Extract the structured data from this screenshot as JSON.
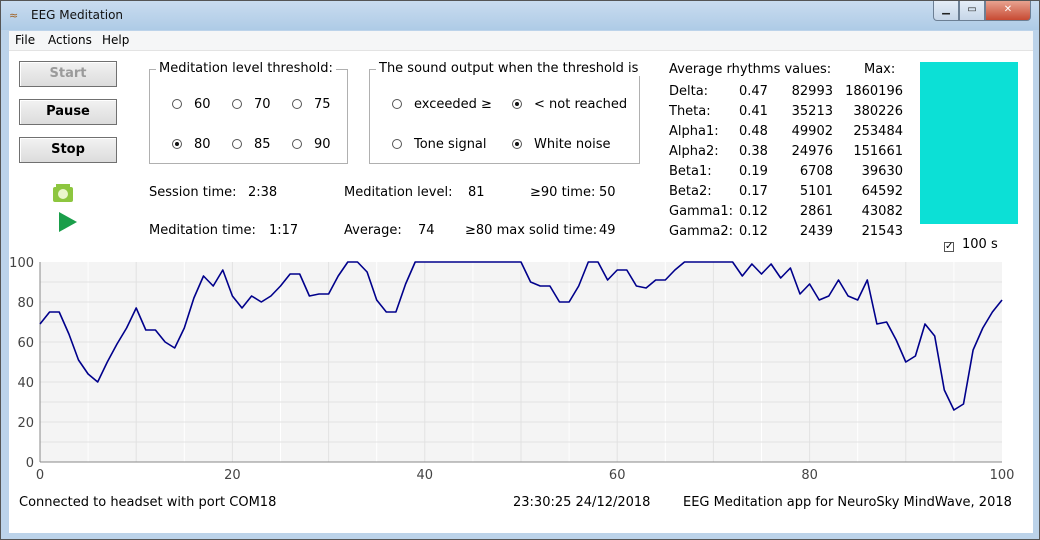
{
  "window": {
    "title": "EEG Meditation",
    "icon": "brain-wave-icon",
    "controls": [
      "minimize",
      "maximize",
      "close"
    ]
  },
  "menu": [
    "File",
    "Actions",
    "Help"
  ],
  "buttons": {
    "start": "Start",
    "pause": "Pause",
    "stop": "Stop"
  },
  "threshold_group": {
    "title": "Meditation level threshold:",
    "options": [
      "60",
      "70",
      "75",
      "80",
      "85",
      "90"
    ],
    "selected": "80"
  },
  "sound_group": {
    "title": "The sound output when the threshold is",
    "condition_options": [
      "exceeded ≥",
      "< not reached"
    ],
    "condition_selected": "< not reached",
    "signal_options": [
      "Tone signal",
      "White noise"
    ],
    "signal_selected": "White noise"
  },
  "stats": {
    "session_time_label": "Session time:",
    "session_time": "2:38",
    "meditation_level_label": "Meditation level:",
    "meditation_level": "81",
    "ge90_label": "≥90 time:",
    "ge90": "50",
    "meditation_time_label": "Meditation time:",
    "meditation_time": "1:17",
    "average_label": "Average:",
    "average": "74",
    "ge80_label": "≥80 max solid time:",
    "ge80": "49"
  },
  "rhythms": {
    "header": "Average rhythms values:",
    "max_header": "Max:",
    "rows": [
      {
        "name": "Delta:",
        "ratio": "0.47",
        "avg": "82993",
        "max": "1860196"
      },
      {
        "name": "Theta:",
        "ratio": "0.41",
        "avg": "35213",
        "max": "380226"
      },
      {
        "name": "Alpha1:",
        "ratio": "0.48",
        "avg": "49902",
        "max": "253484"
      },
      {
        "name": "Alpha2:",
        "ratio": "0.38",
        "avg": "24976",
        "max": "151661"
      },
      {
        "name": "Beta1:",
        "ratio": "0.19",
        "avg": "6708",
        "max": "39630"
      },
      {
        "name": "Beta2:",
        "ratio": "0.17",
        "avg": "5101",
        "max": "64592"
      },
      {
        "name": "Gamma1:",
        "ratio": "0.12",
        "avg": "2861",
        "max": "43082"
      },
      {
        "name": "Gamma2:",
        "ratio": "0.12",
        "avg": "2439",
        "max": "21543"
      }
    ]
  },
  "indicator_color": "#0ce0d6",
  "checkbox": {
    "label": "100 s",
    "checked": true
  },
  "status": {
    "connection": "Connected to headset with port COM18",
    "datetime": "23:30:25  24/12/2018",
    "about": "EEG Meditation app for NeuroSky MindWave, 2018"
  },
  "chart_data": {
    "type": "line",
    "title": "",
    "xlabel": "",
    "ylabel": "",
    "xlim": [
      0,
      100
    ],
    "ylim": [
      0,
      100
    ],
    "xticks": [
      0,
      20,
      40,
      60,
      80,
      100
    ],
    "yticks": [
      0,
      20,
      40,
      60,
      80,
      100
    ],
    "grid": true,
    "line_color": "#00008b",
    "series": [
      {
        "x": [
          0,
          1,
          2,
          3,
          4,
          5,
          6,
          7,
          8,
          9,
          10,
          11,
          12,
          13,
          14,
          15,
          16,
          17,
          18,
          19,
          20,
          21,
          22,
          23,
          24,
          25,
          26,
          27,
          28,
          29,
          30,
          31,
          32,
          33,
          34,
          35,
          36,
          37,
          38,
          39,
          40,
          41,
          42,
          43,
          44,
          45,
          46,
          47,
          48,
          49,
          50,
          51,
          52,
          53,
          54,
          55,
          56,
          57,
          58,
          59,
          60,
          61,
          62,
          63,
          64,
          65,
          66,
          67,
          68,
          69,
          70,
          71,
          72,
          73,
          74,
          75,
          76,
          77,
          78,
          79,
          80,
          81,
          82,
          83,
          84,
          85,
          86,
          87,
          88,
          89,
          90,
          91,
          92,
          93,
          94,
          95,
          96,
          97,
          98,
          99,
          100
        ],
        "y": [
          69,
          75,
          75,
          64,
          51,
          44,
          40,
          50,
          59,
          67,
          77,
          66,
          66,
          60,
          57,
          67,
          82,
          93,
          88,
          96,
          83,
          77,
          83,
          80,
          83,
          88,
          94,
          94,
          83,
          84,
          84,
          93,
          100,
          100,
          95,
          81,
          75,
          75,
          89,
          100,
          100,
          100,
          100,
          100,
          100,
          100,
          100,
          100,
          100,
          100,
          100,
          90,
          88,
          88,
          80,
          80,
          88,
          100,
          100,
          91,
          96,
          96,
          88,
          87,
          91,
          91,
          96,
          100,
          100,
          100,
          100,
          100,
          100,
          93,
          99,
          94,
          99,
          92,
          97,
          84,
          89,
          81,
          83,
          91,
          83,
          81,
          91,
          69,
          70,
          61,
          50,
          53,
          69,
          63,
          36,
          26,
          29,
          56,
          67,
          75,
          81
        ]
      }
    ]
  }
}
